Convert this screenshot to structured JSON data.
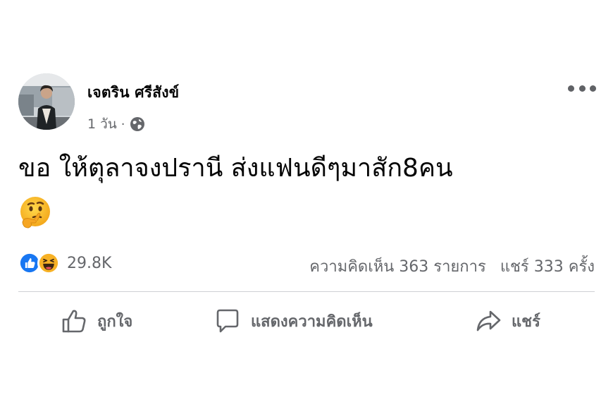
{
  "post": {
    "author": {
      "name": "เจตริน ศรีสังข์",
      "avatar_icon": "profile-photo"
    },
    "meta": {
      "time": "1 วัน",
      "separator": "·",
      "privacy_icon": "globe-icon"
    },
    "text": "ขอ ให้ตุลาจงปรานี ส่งแฟนดีๆมาสัก8คน",
    "emoji": "thinking-face-emoji"
  },
  "stats": {
    "reaction_icons": [
      "like-reaction-icon",
      "haha-reaction-icon"
    ],
    "reaction_count": "29.8K",
    "comments": "ความคิดเห็น 363 รายการ",
    "shares": "แชร์ 333 ครั้ง"
  },
  "actions": {
    "like_label": "ถูกใจ",
    "comment_label": "แสดงความคิดเห็น",
    "share_label": "แชร์"
  },
  "colors": {
    "text_primary": "#050505",
    "text_secondary": "#65676b",
    "like_blue": "#1877f2",
    "haha_yellow": "#f7b125",
    "divider": "#ced0d4"
  }
}
